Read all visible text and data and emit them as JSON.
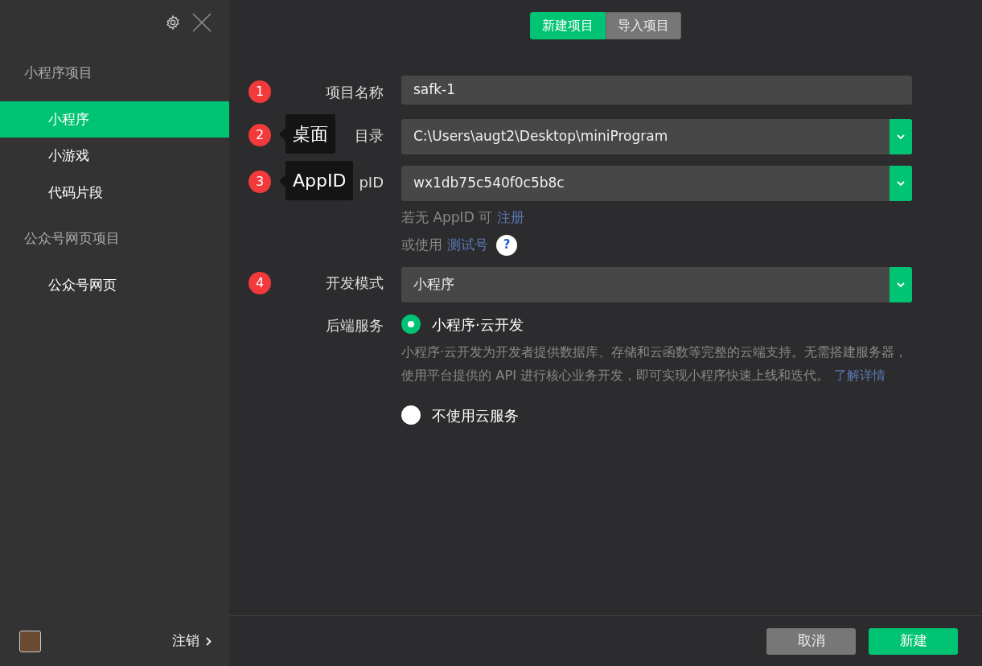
{
  "sidebar": {
    "sections": [
      {
        "title": "小程序项目",
        "items": [
          {
            "label": "小程序",
            "selected": true
          },
          {
            "label": "小游戏",
            "selected": false
          },
          {
            "label": "代码片段",
            "selected": false
          }
        ]
      },
      {
        "title": "公众号网页项目",
        "items": [
          {
            "label": "公众号网页",
            "selected": false
          }
        ]
      }
    ],
    "logout": "注销"
  },
  "tabs": [
    {
      "label": "新建项目",
      "selected": true
    },
    {
      "label": "导入项目",
      "selected": false
    }
  ],
  "form": [
    {
      "kind": "text",
      "marker": "1",
      "label": "项目名称",
      "value": "safk-1"
    },
    {
      "kind": "select",
      "marker": "2",
      "tooltip": "桌面",
      "label": "目录",
      "value": "C:\\Users\\augt2\\Desktop\\miniProgram"
    },
    {
      "kind": "select",
      "marker": "3",
      "tooltip": "AppID",
      "label": "pID",
      "value": "wx1db75c540f0c5b8c",
      "hints": [
        {
          "text": "若无 AppID 可",
          "link": "注册"
        },
        {
          "text": "或使用",
          "link": "测试号",
          "help": "?"
        }
      ]
    },
    {
      "kind": "select",
      "marker": "4",
      "label": "开发模式",
      "value": "小程序"
    },
    {
      "kind": "radio",
      "label": "后端服务",
      "options": [
        {
          "label": "小程序·云开发",
          "selected": true,
          "description": "小程序·云开发为开发者提供数据库、存储和云函数等完整的云端支持。无需搭建服务器，使用平台提供的 API 进行核心业务开发，即可实现小程序快速上线和迭代。",
          "link": "了解详情"
        },
        {
          "label": "不使用云服务",
          "selected": false
        }
      ]
    }
  ],
  "buttons": [
    {
      "label": "取消",
      "kind": "secondary"
    },
    {
      "label": "新建",
      "kind": "primary"
    }
  ]
}
